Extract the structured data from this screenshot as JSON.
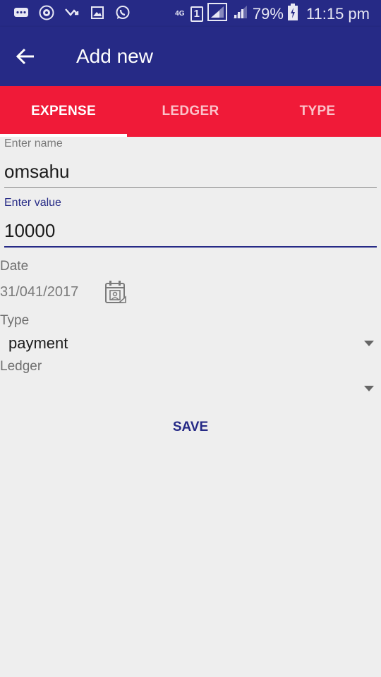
{
  "status_bar": {
    "icons": [
      "message-icon",
      "browser-icon",
      "missed-call-icon",
      "gallery-icon",
      "whatsapp-icon"
    ],
    "network": "4G",
    "sim": "1",
    "battery": "79%",
    "time": "11:15 pm"
  },
  "app_bar": {
    "title": "Add new"
  },
  "tabs": [
    {
      "label": "EXPENSE",
      "active": true
    },
    {
      "label": "LEDGER",
      "active": false
    },
    {
      "label": "TYPE",
      "active": false
    }
  ],
  "form": {
    "name": {
      "label": "Enter name",
      "value": "omsahu"
    },
    "value": {
      "label": "Enter value",
      "value": "10000"
    },
    "date": {
      "label": "Date",
      "value": "31/041/2017"
    },
    "type": {
      "label": "Type",
      "selected": "payment"
    },
    "ledger": {
      "label": "Ledger",
      "selected": ""
    }
  },
  "save_label": "SAVE",
  "colors": {
    "primary": "#262a86",
    "accent": "#f01a38",
    "background": "#eeeeee"
  }
}
